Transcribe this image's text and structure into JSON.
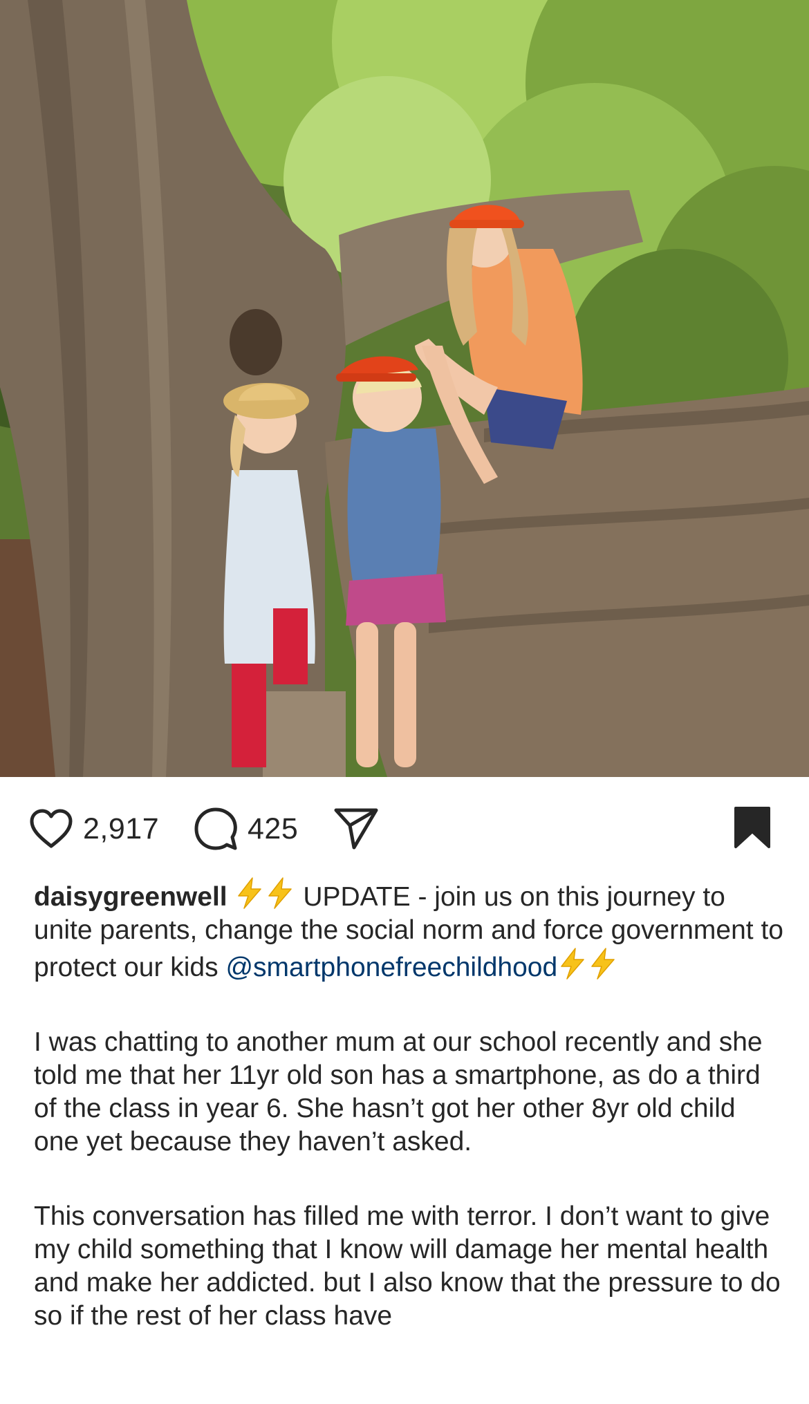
{
  "post": {
    "photo_alt": "",
    "likes": "2,917",
    "comments": "425"
  },
  "caption": {
    "username": "daisygreenwell",
    "text_1": " UPDATE - join us on this journey to unite parents, change the social norm and force government to protect our kids ",
    "mention": "@smartphonefreechildhood",
    "para_1": "I was chatting to another mum at our school recently and she told me that her 11yr old son has a smartphone, as do a third of the class in year 6. She hasn’t got her other 8yr old child one yet because they haven’t asked.",
    "para_2": "This conversation has filled me with terror. I don’t want to give my child something that I know will damage her mental health and make her addicted. but I also know that the pressure to do so if the rest of her class have"
  },
  "icons": {
    "like": "heart-outline-icon",
    "comment": "comment-bubble-icon",
    "share": "paper-plane-icon",
    "save": "bookmark-filled-icon",
    "emoji": "high-voltage-emoji-icon"
  },
  "colors": {
    "text": "#262626",
    "mention": "#00376b",
    "bolt": "#f7c21a"
  }
}
